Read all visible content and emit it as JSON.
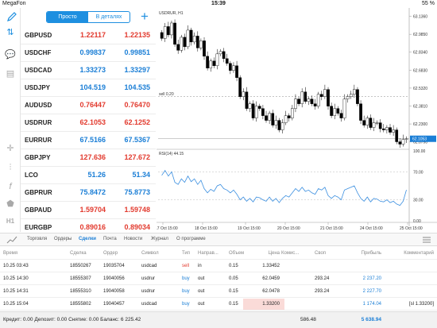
{
  "status": {
    "carrier": "MegaFon",
    "time": "15:39",
    "battery": "55 %"
  },
  "toolbar": {
    "tab_simple": "Просто",
    "tab_detailed": "В деталях"
  },
  "quotes": [
    {
      "symbol": "GBPUSD",
      "bid": "1.22117",
      "ask": "1.22135",
      "color": "red"
    },
    {
      "symbol": "USDCHF",
      "bid": "0.99837",
      "ask": "0.99851",
      "color": "blue"
    },
    {
      "symbol": "USDCAD",
      "bid": "1.33273",
      "ask": "1.33297",
      "color": "blue"
    },
    {
      "symbol": "USDJPY",
      "bid": "104.519",
      "ask": "104.535",
      "color": "blue"
    },
    {
      "symbol": "AUDUSD",
      "bid": "0.76447",
      "ask": "0.76470",
      "color": "red"
    },
    {
      "symbol": "USDRUR",
      "bid": "62.1053",
      "ask": "62.1252",
      "color": "red"
    },
    {
      "symbol": "EURRUR",
      "bid": "67.5166",
      "ask": "67.5367",
      "color": "blue"
    },
    {
      "symbol": "GBPJPY",
      "bid": "127.636",
      "ask": "127.672",
      "color": "red"
    },
    {
      "symbol": "LCO",
      "bid": "51.26",
      "ask": "51.34",
      "color": "blue"
    },
    {
      "symbol": "GBPRUR",
      "bid": "75.8472",
      "ask": "75.8773",
      "color": "blue"
    },
    {
      "symbol": "GBPAUD",
      "bid": "1.59704",
      "ask": "1.59748",
      "color": "red"
    },
    {
      "symbol": "EURGBP",
      "bid": "0.89016",
      "ask": "0.89034",
      "color": "red"
    }
  ],
  "chart": {
    "title": "USDRUR, H1",
    "sell_label": "sell 0.20",
    "current_price": "62.1053",
    "rsi_label": "RSI(14) 44.15",
    "price_ticks": [
      "63.1360",
      "62.9850",
      "62.8340",
      "62.6830",
      "62.5320",
      "62.3810",
      "62.2300",
      "62.0790"
    ],
    "rsi_ticks": [
      "100.00",
      "70.00",
      "30.00",
      "0.00"
    ],
    "time_labels": [
      "17 Oct 15:00",
      "18 Oct 15:00",
      "19 Oct 15:00",
      "20 Oct 15:00",
      "21 Oct 15:00",
      "24 Oct 15:00",
      "25 Oct 15:00"
    ]
  },
  "chart_data": {
    "type": "candlestick",
    "title": "USDRUR, H1",
    "ylim": [
      62.03,
      63.18
    ],
    "close": [
      62.95,
      63.05,
      62.98,
      63.08,
      62.9,
      62.85,
      62.96,
      62.88,
      63.02,
      62.92,
      62.97,
      62.87,
      62.93,
      62.8,
      62.7,
      62.76,
      62.72,
      62.82,
      62.84,
      62.78,
      62.74,
      62.68,
      62.72,
      62.62,
      62.46,
      62.5,
      62.36,
      62.4,
      62.28,
      62.38,
      62.36,
      62.3,
      62.26,
      62.32,
      62.22,
      62.26,
      62.18,
      62.24,
      62.3,
      62.28,
      62.36,
      62.44,
      62.4,
      62.5,
      62.42,
      62.44,
      62.4,
      62.38,
      62.48,
      62.46,
      62.52,
      62.38,
      62.3,
      62.36,
      62.32,
      62.28,
      62.44,
      62.46,
      62.48,
      62.52,
      62.4,
      62.26,
      62.22,
      62.28,
      62.2,
      62.24,
      62.24,
      62.19,
      62.18,
      62.2,
      62.16,
      62.18,
      62.08,
      62.06,
      62.1,
      62.1053
    ],
    "rsi": [
      65,
      72,
      64,
      70,
      55,
      52,
      60,
      55,
      64,
      56,
      60,
      52,
      58,
      46,
      40,
      45,
      42,
      50,
      52,
      46,
      44,
      40,
      44,
      38,
      30,
      34,
      28,
      32,
      27,
      34,
      33,
      30,
      28,
      34,
      28,
      32,
      26,
      32,
      36,
      34,
      40,
      46,
      42,
      48,
      42,
      44,
      40,
      38,
      46,
      44,
      48,
      36,
      32,
      36,
      34,
      30,
      44,
      46,
      48,
      50,
      40,
      32,
      28,
      34,
      27,
      32,
      31,
      28,
      27,
      30,
      26,
      28,
      24,
      22,
      28,
      44.15
    ]
  },
  "bottom_tabs": [
    "Торговля",
    "Ордеры",
    "Сделки",
    "Почта",
    "Новости",
    "Журнал",
    "О программе"
  ],
  "deals": {
    "headers": [
      "Время",
      "Сделка",
      "Ордер",
      "Символ",
      "Тип",
      "Направ...",
      "Объем",
      "Цена",
      "Комис...",
      "Своп",
      "Прибыль",
      "Комментарий"
    ],
    "rows": [
      [
        "10.25 03:43",
        "18550267",
        "19035704",
        "usdcad",
        "sell",
        "in",
        "0.15",
        "1.33452",
        "",
        "",
        "",
        ""
      ],
      [
        "10.25 14:30",
        "18555307",
        "19040056",
        "usdrur",
        "buy",
        "out",
        "0.05",
        "62.0459",
        "",
        "293.24",
        "2 237.20",
        ""
      ],
      [
        "10.25 14:31",
        "18555310",
        "19040058",
        "usdrur",
        "buy",
        "out",
        "0.15",
        "62.0478",
        "",
        "293.24",
        "2 227.70",
        ""
      ],
      [
        "10.25 15:04",
        "18555802",
        "19040457",
        "usdcad",
        "buy",
        "out",
        "0.15",
        "1.33200",
        "",
        "",
        "1 174.04",
        "[sl 1.33200]"
      ]
    ]
  },
  "footer": {
    "summary": "Кредит: 0.00 Депозит: 0.00 Снятие: 0.00 Баланс: 6 225.42",
    "swap_total": "586.48",
    "profit_total": "5 638.94"
  }
}
